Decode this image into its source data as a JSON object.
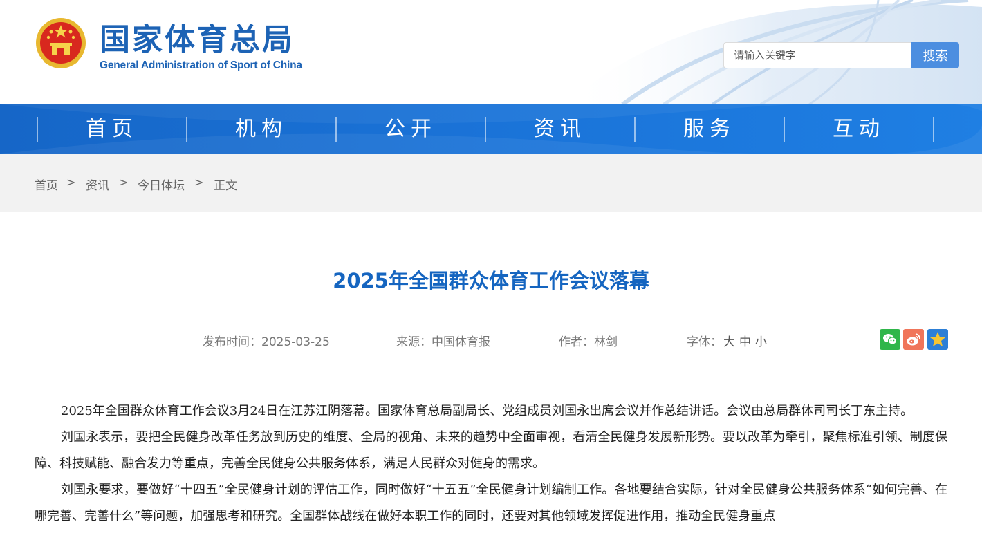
{
  "header": {
    "title": "国家体育总局",
    "subtitle": "General Administration of Sport of China",
    "search_placeholder": "请输入关键字",
    "search_button": "搜索",
    "colors": {
      "brand": "#1d63b5",
      "search_button": "#4c8ee0"
    }
  },
  "nav": {
    "items": [
      {
        "label": "首页"
      },
      {
        "label": "机构"
      },
      {
        "label": "公开"
      },
      {
        "label": "资讯"
      },
      {
        "label": "服务"
      },
      {
        "label": "互动"
      }
    ],
    "color": "#1a73d8"
  },
  "breadcrumb": {
    "items": [
      "首页",
      "资讯",
      "今日体坛",
      "正文"
    ],
    "separator": ">"
  },
  "article": {
    "title": "2025年全国群众体育工作会议落幕",
    "publish_label": "发布时间：",
    "publish_date": "2025-03-25",
    "source_label": "来源：",
    "source": "中国体育报",
    "author_label": "作者：",
    "author": "林剑",
    "font_label": "字体：",
    "font_options": [
      "大",
      "中",
      "小"
    ],
    "share_icons": [
      "wechat-icon",
      "weibo-icon",
      "qzone-icon"
    ],
    "paragraphs": [
      "2025年全国群众体育工作会议3月24日在江苏江阴落幕。国家体育总局副局长、党组成员刘国永出席会议并作总结讲话。会议由总局群体司司长丁东主持。",
      "刘国永表示，要把全民健身改革任务放到历史的维度、全局的视角、未来的趋势中全面审视，看清全民健身发展新形势。要以改革为牵引，聚焦标准引领、制度保障、科技赋能、融合发力等重点，完善全民健身公共服务体系，满足人民群众对健身的需求。",
      "刘国永要求，要做好“十四五”全民健身计划的评估工作，同时做好“十五五”全民健身计划编制工作。各地要结合实际，针对全民健身公共服务体系“如何完善、在哪完善、完善什么”等问题，加强思考和研究。全国群体战线在做好本职工作的同时，还要对其他领域发挥促进作用，推动全民健身重点"
    ]
  }
}
